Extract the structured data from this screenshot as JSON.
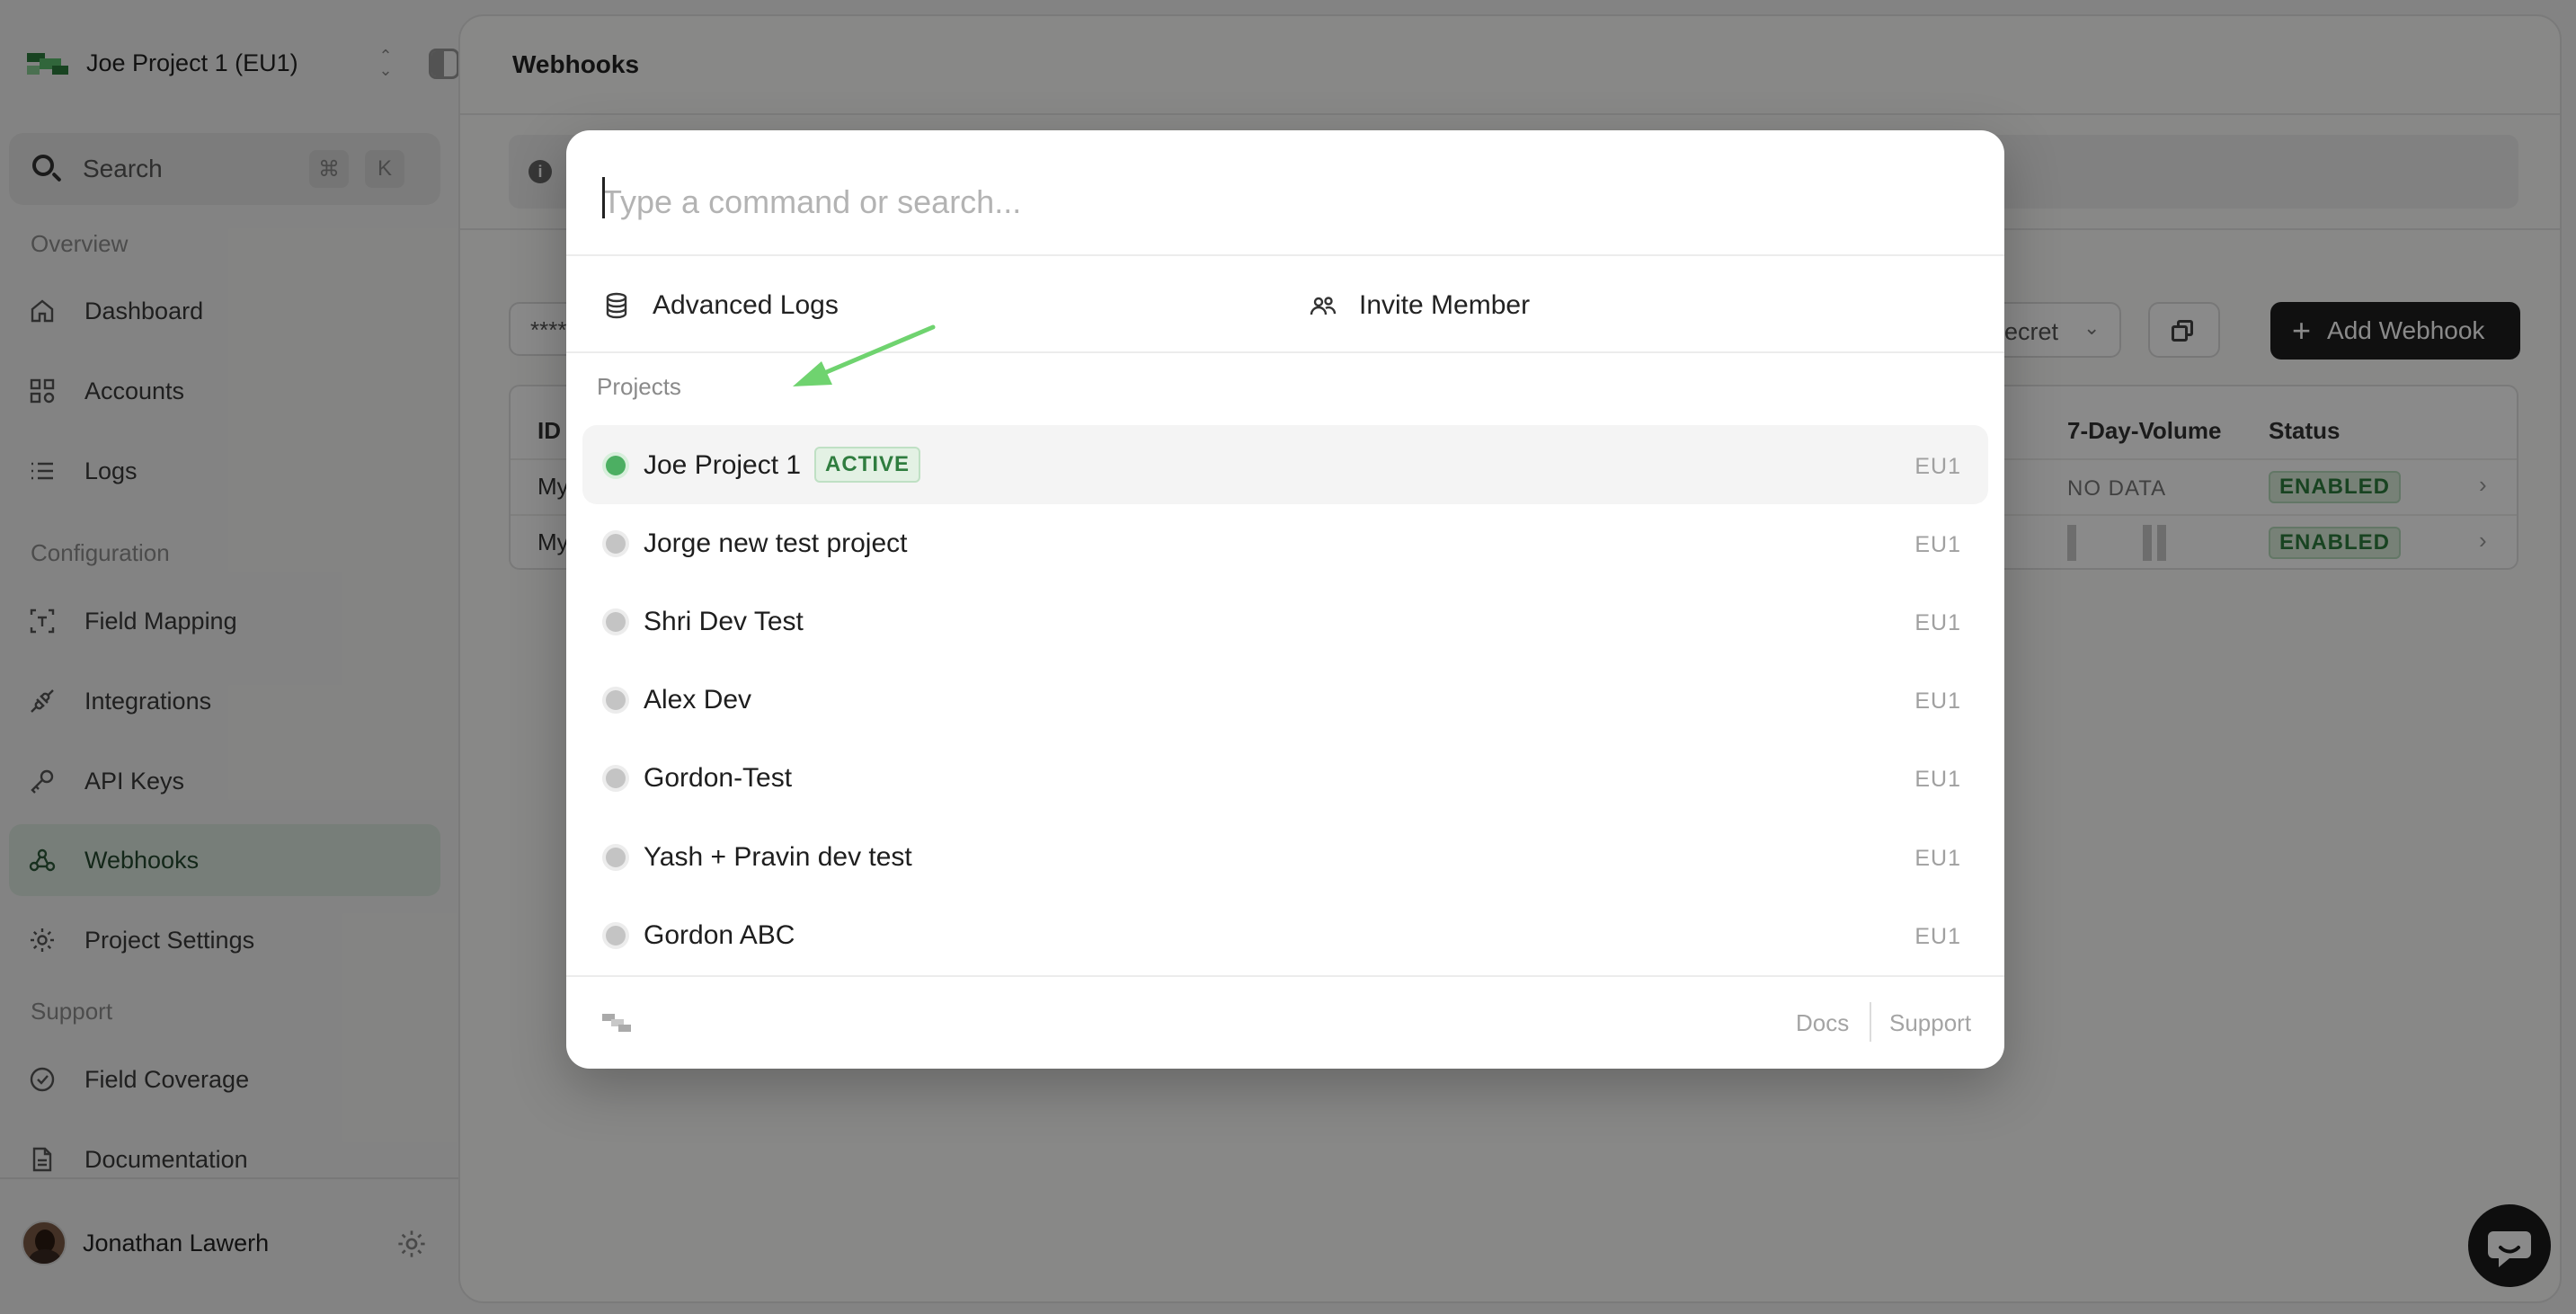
{
  "sidebar": {
    "project_name": "Joe Project 1 (EU1)",
    "search_label": "Search",
    "shortcut_cmd": "⌘",
    "shortcut_key": "K",
    "sections": {
      "overview": "Overview",
      "configuration": "Configuration",
      "support": "Support"
    },
    "items": [
      {
        "label": "Dashboard",
        "icon": "home-icon"
      },
      {
        "label": "Accounts",
        "icon": "grid-icon"
      },
      {
        "label": "Logs",
        "icon": "list-icon"
      },
      {
        "label": "Field Mapping",
        "icon": "text-frame-icon"
      },
      {
        "label": "Integrations",
        "icon": "plug-icon"
      },
      {
        "label": "API Keys",
        "icon": "key-icon"
      },
      {
        "label": "Webhooks",
        "icon": "webhook-icon",
        "active": true
      },
      {
        "label": "Project Settings",
        "icon": "gear-icon"
      },
      {
        "label": "Field Coverage",
        "icon": "check-circle-icon"
      },
      {
        "label": "Documentation",
        "icon": "document-icon"
      }
    ],
    "user_name": "Jonathan Lawerh"
  },
  "main": {
    "title": "Webhooks",
    "secret_masked": "****",
    "secret_dropdown": "ecret",
    "add_button": "Add Webhook",
    "table": {
      "headers": {
        "id": "ID",
        "volume": "7-Day-Volume",
        "status": "Status"
      },
      "rows": [
        {
          "id": "My",
          "volume": "NO DATA",
          "status": "ENABLED"
        },
        {
          "id": "My",
          "volume": "",
          "status": "ENABLED"
        }
      ]
    }
  },
  "palette": {
    "placeholder": "Type a command or search...",
    "quick_actions": [
      {
        "label": "Advanced Logs",
        "icon": "database-icon"
      },
      {
        "label": "Invite Member",
        "icon": "users-icon"
      }
    ],
    "group_label": "Projects",
    "projects": [
      {
        "name": "Joe Project 1",
        "badge": "ACTIVE",
        "region": "EU1",
        "active": true
      },
      {
        "name": "Jorge new test project",
        "region": "EU1"
      },
      {
        "name": "Shri Dev Test",
        "region": "EU1"
      },
      {
        "name": "Alex Dev",
        "region": "EU1"
      },
      {
        "name": "Gordon-Test",
        "region": "EU1"
      },
      {
        "name": "Yash + Pravin dev test",
        "region": "EU1"
      },
      {
        "name": "Gordon ABC",
        "region": "EU1"
      }
    ],
    "footer": {
      "docs": "Docs",
      "support": "Support"
    }
  },
  "colors": {
    "accent_green": "#4caf62",
    "arrow_green": "#6fd36f",
    "dark_button": "#1e1e1e"
  }
}
